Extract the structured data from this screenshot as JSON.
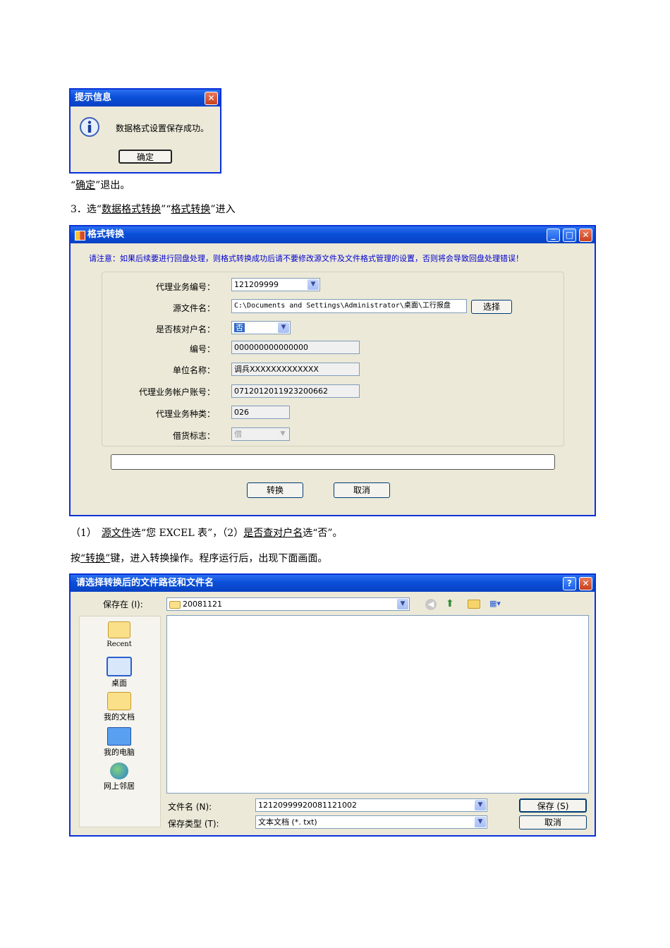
{
  "dialog1": {
    "title": "提示信息",
    "close": "✕",
    "message": "数据格式设置保存成功。",
    "ok": "确定"
  },
  "para1": {
    "open": "“",
    "link": "确定",
    "rest": "”退出。"
  },
  "para2": {
    "prefix": "3．选“",
    "link1": "数据格式转换",
    "mid": "”“",
    "link2": "格式转换",
    "suffix": "”进入"
  },
  "win2": {
    "title": "格式转换",
    "notice": "请注意：如果后续要进行回盘处理，则格式转换成功后请不要修改源文件及文件格式管理的设置，否则将会导致回盘处理错误！",
    "fields": {
      "agent_no_label": "代理业务编号：",
      "agent_no_value": "121209999",
      "src_label": "源文件名：",
      "src_value": "C:\\Documents and Settings\\Administrator\\桌面\\工行报盘",
      "choose": "选择",
      "check_label": "是否核对户名：",
      "check_value": "否",
      "code_label": "编号：",
      "code_value": "000000000000000",
      "unit_label": "单位名称：",
      "unit_value": "调兵XXXXXXXXXXXXX",
      "account_label": "代理业务帐户账号：",
      "account_value": "0712012011923200662",
      "type_label": "代理业务种类：",
      "type_value": "026",
      "debit_label": "借货标志：",
      "debit_value": "借"
    },
    "convert": "转换",
    "cancel": "取消"
  },
  "para3": {
    "p1": "（1）　",
    "l1": "源文件",
    "p2": "选“您 EXCEL 表”，（2）",
    "l2": "是否查对户名",
    "p3": "选“否”。"
  },
  "para4": {
    "p1": "按",
    "l1": "“转换”",
    "p2": "键，进入转换操作。程序运行后，出现下面画面。"
  },
  "win3": {
    "title": "请选择转换后的文件路径和文件名",
    "help": "?",
    "save_in_label": "保存在 (I):",
    "save_in_value": "20081121",
    "places": [
      "Recent",
      "桌面",
      "我的文档",
      "我的电脑",
      "网上邻居"
    ],
    "filename_label": "文件名 (N):",
    "filename_value": "12120999920081121002",
    "filetype_label": "保存类型 (T):",
    "filetype_value": "文本文档 (*. txt)",
    "save": "保存 (S)",
    "cancel": "取消"
  },
  "colors": {
    "xp_blue": "#0831d9",
    "xp_face": "#ece9d8",
    "notice_blue": "#0000cc"
  },
  "icons": [
    "info-icon",
    "close-icon",
    "minimize-icon",
    "maximize-icon",
    "help-icon",
    "folder-icon",
    "dropdown-arrow-icon",
    "back-icon",
    "up-folder-icon",
    "new-folder-icon",
    "view-menu-icon",
    "recent-icon",
    "desktop-icon",
    "my-documents-icon",
    "my-computer-icon",
    "network-icon"
  ]
}
